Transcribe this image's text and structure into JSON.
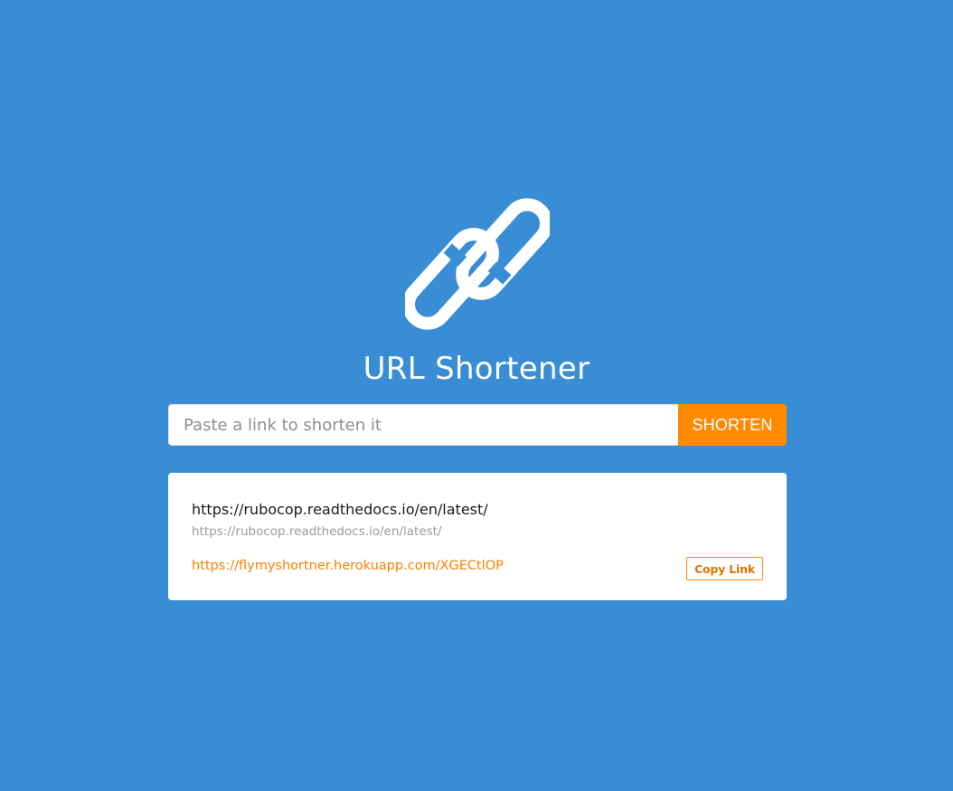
{
  "header": {
    "logo_icon": "chain-link-icon",
    "title": "URL Shortener"
  },
  "shorten_form": {
    "input_value": "",
    "input_placeholder": "Paste a link to shorten it",
    "button_label": "SHORTEN"
  },
  "result": {
    "original_url": "https://rubocop.readthedocs.io/en/latest/",
    "original_url_secondary": "https://rubocop.readthedocs.io/en/latest/",
    "short_url": "https://flymyshortner.herokuapp.com/XGECtlOP",
    "copy_button_label": "Copy Link"
  },
  "colors": {
    "background": "#398dd5",
    "accent": "#ff8a00",
    "card": "#ffffff"
  }
}
